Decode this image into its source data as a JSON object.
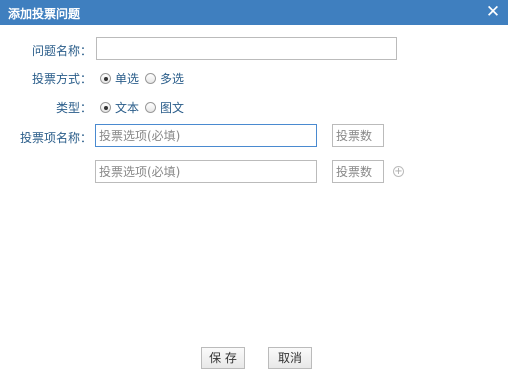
{
  "dialog": {
    "title": "添加投票问题",
    "close_icon": "close-icon"
  },
  "form": {
    "question_name": {
      "label": "问题名称：",
      "value": ""
    },
    "vote_mode": {
      "label": "投票方式：",
      "options": [
        {
          "label": "单选",
          "checked": true
        },
        {
          "label": "多选",
          "checked": false
        }
      ]
    },
    "type": {
      "label": "类型：",
      "options": [
        {
          "label": "文本",
          "checked": true
        },
        {
          "label": "图文",
          "checked": false
        }
      ]
    },
    "vote_items": {
      "label": "投票项名称：",
      "rows": [
        {
          "option_placeholder": "投票选项(必填)",
          "count_placeholder": "投票数"
        },
        {
          "option_placeholder": "投票选项(必填)",
          "count_placeholder": "投票数"
        }
      ],
      "add_icon": "plus-circle-icon"
    }
  },
  "buttons": {
    "save_label": "保 存",
    "cancel_label": "取消"
  },
  "colors": {
    "titlebar": "#3f7fbf",
    "label_text": "#2a5d8a"
  }
}
